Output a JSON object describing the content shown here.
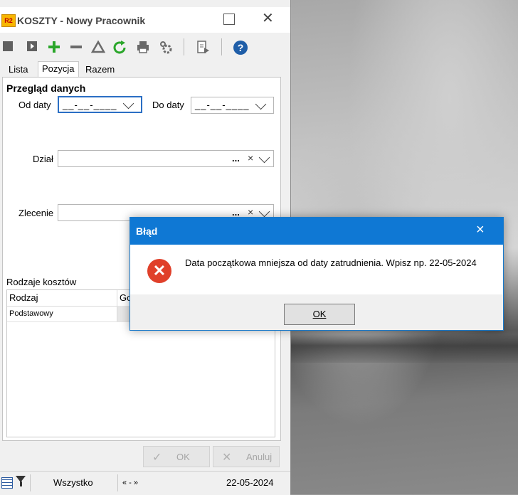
{
  "window": {
    "logo_text": "R2",
    "title": "KOSZTY - Nowy  Pracownik"
  },
  "tabs": [
    {
      "label": "Lista"
    },
    {
      "label": "Pozycja"
    },
    {
      "label": "Razem"
    }
  ],
  "form": {
    "section_title": "Przegląd danych",
    "od_daty_label": "Od daty",
    "od_daty_value": "__-__-____",
    "do_daty_label": "Do daty",
    "do_daty_value": "__-__-____",
    "dzial_label": "Dział",
    "zlecenie_label": "Zlecenie",
    "dots": "...",
    "clear": "×"
  },
  "grid": {
    "title": "Rodzaje kosztów",
    "columns": [
      "Rodzaj",
      "Go"
    ],
    "rows": [
      [
        "Podstawowy",
        ""
      ]
    ]
  },
  "buttons": {
    "ok": "OK",
    "cancel": "Anuluj"
  },
  "statusbar": {
    "filter": "Wszystko",
    "nav": "« - »",
    "date": "22-05-2024"
  },
  "dialog": {
    "title": "Błąd",
    "close": "×",
    "message": "Data początkowa mniejsza od daty zatrudnienia. Wpisz np. 22-05-2024",
    "ok_button": "OK"
  },
  "colors": {
    "dialog_title_bg": "#0f78d4",
    "error_icon": "#e0402a",
    "focus_border": "#2b6fc4"
  }
}
